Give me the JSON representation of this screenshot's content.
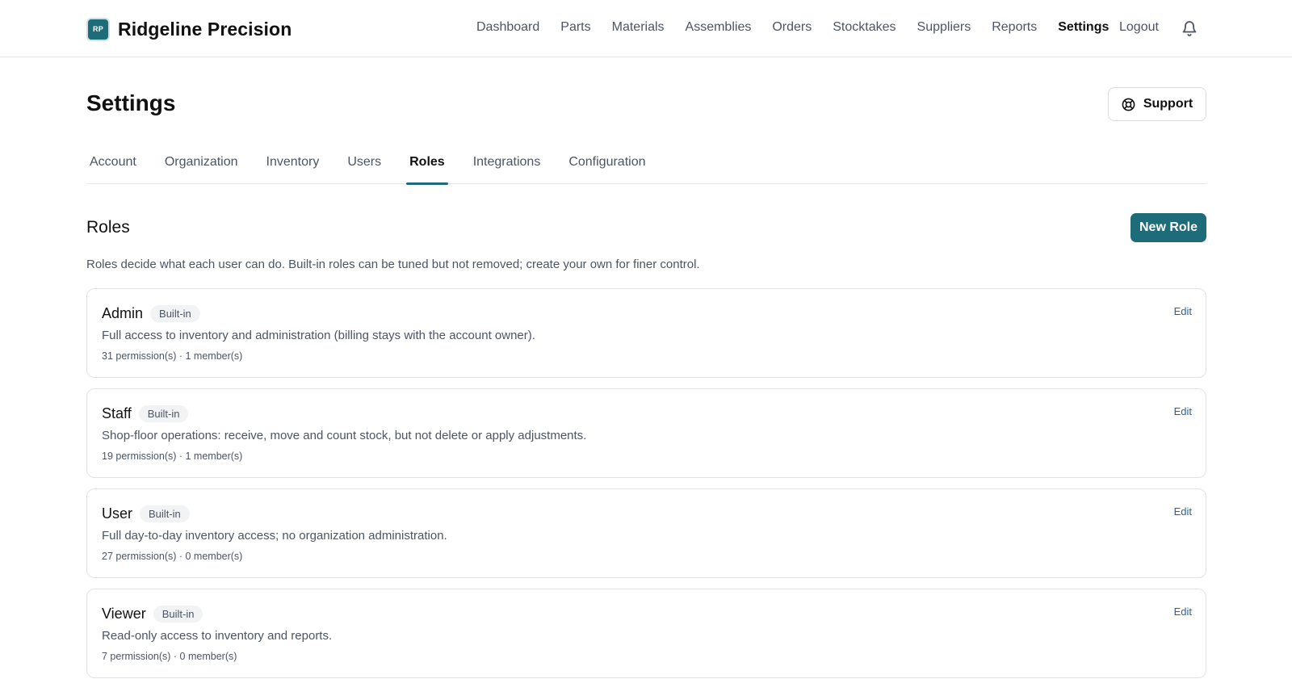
{
  "brand": {
    "logo_text": "RP",
    "name": "Ridgeline Precision",
    "accent_color": "#1e6b7a"
  },
  "nav": {
    "items": [
      {
        "label": "Dashboard",
        "active": false
      },
      {
        "label": "Parts",
        "active": false
      },
      {
        "label": "Materials",
        "active": false
      },
      {
        "label": "Assemblies",
        "active": false
      },
      {
        "label": "Orders",
        "active": false
      },
      {
        "label": "Stocktakes",
        "active": false
      },
      {
        "label": "Suppliers",
        "active": false
      },
      {
        "label": "Reports",
        "active": false
      },
      {
        "label": "Settings",
        "active": true
      }
    ],
    "logout_label": "Logout",
    "notifications_icon": "bell-icon"
  },
  "page": {
    "title": "Settings",
    "support_label": "Support",
    "support_icon": "lifebuoy-icon"
  },
  "tabs": [
    {
      "label": "Account",
      "active": false
    },
    {
      "label": "Organization",
      "active": false
    },
    {
      "label": "Inventory",
      "active": false
    },
    {
      "label": "Users",
      "active": false
    },
    {
      "label": "Roles",
      "active": true
    },
    {
      "label": "Integrations",
      "active": false
    },
    {
      "label": "Configuration",
      "active": false
    }
  ],
  "roles": {
    "title": "Roles",
    "new_role_label": "New Role",
    "description": "Roles decide what each user can do. Built-in roles can be tuned but not removed; create your own for finer control.",
    "items": [
      {
        "name": "Admin",
        "badge": "Built-in",
        "description": "Full access to inventory and administration (billing stays with the account owner).",
        "meta": "31 permission(s) · 1 member(s)",
        "edit_label": "Edit"
      },
      {
        "name": "Staff",
        "badge": "Built-in",
        "description": "Shop-floor operations: receive, move and count stock, but not delete or apply adjustments.",
        "meta": "19 permission(s) · 1 member(s)",
        "edit_label": "Edit"
      },
      {
        "name": "User",
        "badge": "Built-in",
        "description": "Full day-to-day inventory access; no organization administration.",
        "meta": "27 permission(s) · 0 member(s)",
        "edit_label": "Edit"
      },
      {
        "name": "Viewer",
        "badge": "Built-in",
        "description": "Read-only access to inventory and reports.",
        "meta": "7 permission(s) · 0 member(s)",
        "edit_label": "Edit"
      }
    ]
  }
}
